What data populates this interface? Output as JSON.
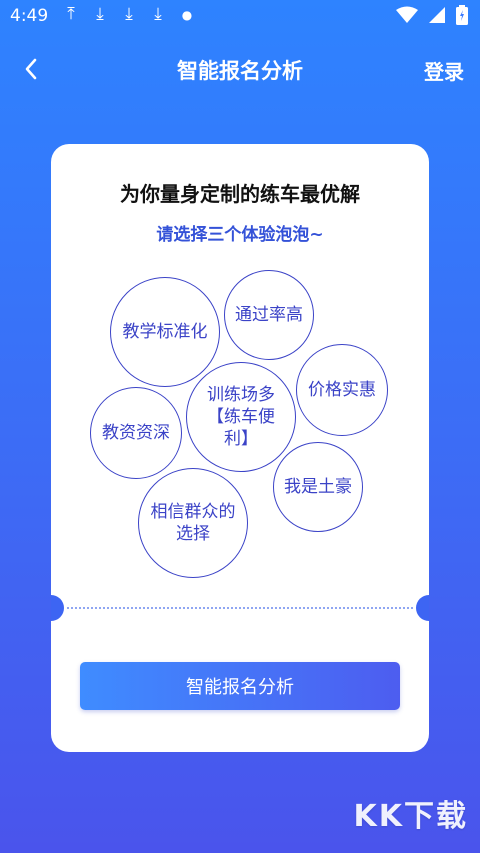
{
  "status_bar": {
    "time": "4:49",
    "notification_icons": [
      "upload-icon",
      "download-icon",
      "download-icon",
      "download-icon",
      "dot-icon"
    ],
    "right_icons": [
      "wifi-icon",
      "signal-icon",
      "battery-icon"
    ]
  },
  "header": {
    "back_icon": "chevron-left-icon",
    "title": "智能报名分析",
    "login_label": "登录"
  },
  "card": {
    "title": "为你量身定制的练车最优解",
    "subtitle": "请选择三个体验泡泡~",
    "bubbles": [
      {
        "label": "教学标准化"
      },
      {
        "label": "通过率高"
      },
      {
        "label": "价格实惠"
      },
      {
        "label": "训练场多【练车便利】"
      },
      {
        "label": "教资资深"
      },
      {
        "label": "我是土豪"
      },
      {
        "label": "相信群众的选择"
      }
    ],
    "cta_label": "智能报名分析"
  },
  "watermark": "KK下载",
  "colors": {
    "background_top": "#2e83ff",
    "background_bottom": "#4a54ec",
    "accent": "#3452d8",
    "bubble_border": "#3b43c7"
  }
}
